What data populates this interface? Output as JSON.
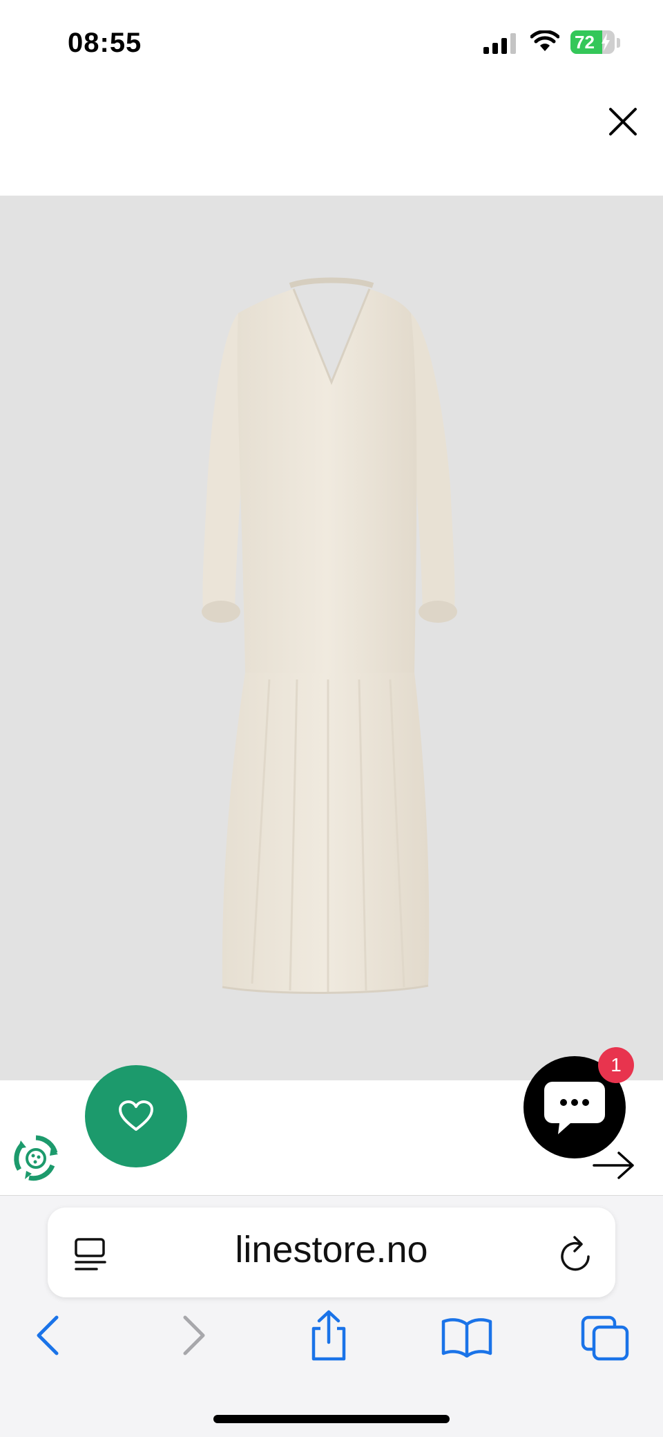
{
  "status_bar": {
    "time": "08:55",
    "battery": "72",
    "battery_level": 0.72
  },
  "icons": {
    "signal": "cellular-signal-icon",
    "wifi": "wifi-icon",
    "battery": "battery-charging-icon",
    "close": "close-icon",
    "product": "cream-maxi-dress-photo",
    "eco": "recycle-eco-icon",
    "favorite": "heart-icon",
    "chat": "chat-bubble-icon",
    "next": "arrow-right-icon",
    "reader": "reader-mode-icon",
    "reload": "reload-icon",
    "back": "chevron-left-icon",
    "forward": "chevron-right-icon",
    "share": "share-icon",
    "bookmarks": "book-icon",
    "tabs": "tabs-icon"
  },
  "chat": {
    "badge_count": "1"
  },
  "browser": {
    "url": "linestore.no"
  },
  "colors": {
    "favorite_green": "#1c9a6c",
    "badge_red": "#e8344e",
    "safari_blue": "#1a73e8",
    "image_background": "#e2e2e2",
    "dress": "#ede7dc"
  }
}
